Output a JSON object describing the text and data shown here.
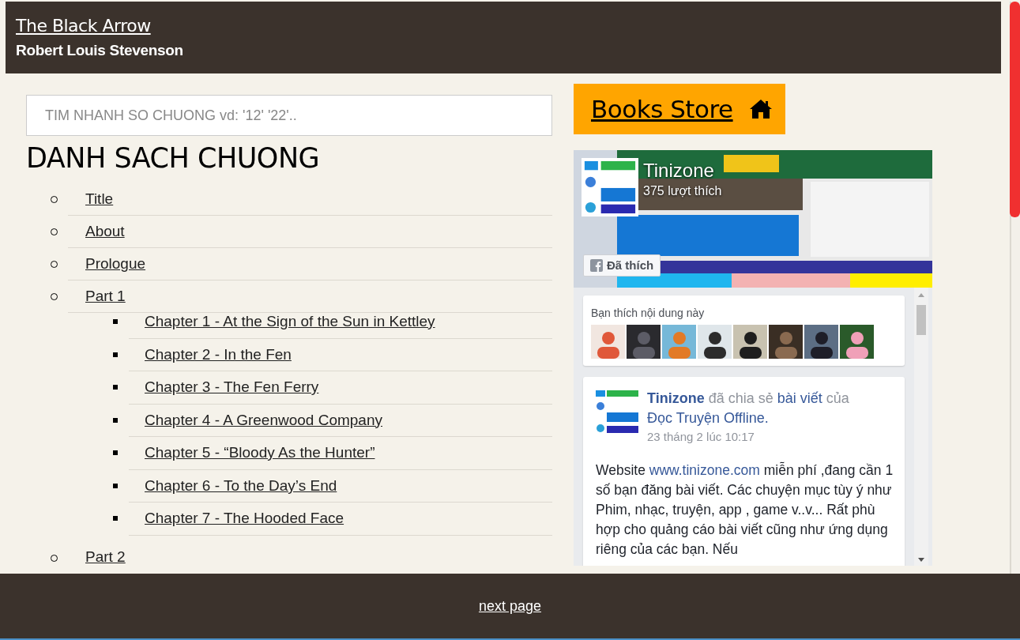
{
  "header": {
    "title": "The Black Arrow",
    "author": "Robert Louis Stevenson"
  },
  "search": {
    "placeholder": "TIM NHANH SO CHUONG vd: '12' '22'.."
  },
  "chapter_list": {
    "heading": "DANH SACH CHUONG",
    "items": [
      {
        "label": "Title"
      },
      {
        "label": "About"
      },
      {
        "label": "Prologue"
      },
      {
        "label": "Part 1",
        "children": [
          {
            "label": "Chapter 1 - At the Sign of the Sun in Kettley"
          },
          {
            "label": "Chapter 2 - In the Fen"
          },
          {
            "label": "Chapter 3 - The Fen Ferry"
          },
          {
            "label": "Chapter 4 - A Greenwood Company"
          },
          {
            "label": "Chapter 5 - “Bloody As the Hunter”"
          },
          {
            "label": "Chapter 6 - To the Day’s End"
          },
          {
            "label": "Chapter 7 - The Hooded Face"
          }
        ]
      },
      {
        "label": "Part 2"
      }
    ]
  },
  "store_button": {
    "label": "Books Store"
  },
  "facebook_widget": {
    "page_name": "Tinizone",
    "likes": "375 lượt thích",
    "like_button": "Đã thích",
    "friends_heading": "Bạn thích nội dung này",
    "post": {
      "header": [
        {
          "kind": "author",
          "text": "Tinizone"
        },
        {
          "kind": "plain",
          "text": "đã chia sẻ"
        },
        {
          "kind": "link",
          "text": "bài viết"
        },
        {
          "kind": "plain",
          "text": "của"
        },
        {
          "kind": "link",
          "text": "Đọc Truyện Offline."
        }
      ],
      "time": "23 tháng 2 lúc 10:17",
      "body": [
        {
          "kind": "plain",
          "text": "Website"
        },
        {
          "kind": "link",
          "text": "www.tinizone.com"
        },
        {
          "kind": "plain",
          "text": "miễn phí ,đang cần 1 số bạn đăng bài viết. Các chuyện mục tùy ý như Phim, nhạc, truyện, app , game v..v... Rất phù hợp cho quảng cáo bài viết cũng như ứng dụng riêng của các bạn. Nếu"
        }
      ]
    }
  },
  "footer": {
    "next_page": "next page"
  }
}
